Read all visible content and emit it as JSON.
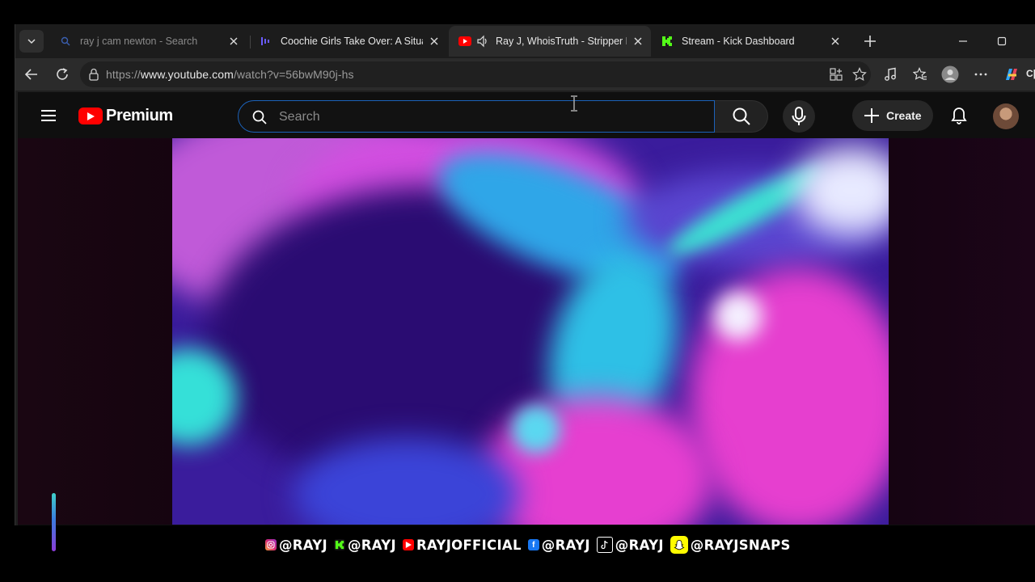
{
  "browser": {
    "tabs": [
      {
        "title": "ray j cam newton - Search",
        "favicon": "search-icon",
        "active": false,
        "dim": true
      },
      {
        "title": "Coochie Girls Take Over: A Situatio",
        "favicon": "podcast-wave-icon",
        "active": false,
        "dim": false
      },
      {
        "title": "Ray J, WhoisTruth - Stripper B",
        "favicon": "youtube-icon",
        "active": true,
        "dim": false,
        "audio": true
      },
      {
        "title": "Stream - Kick Dashboard",
        "favicon": "kick-icon",
        "active": false,
        "dim": false
      }
    ],
    "url_prefix": "https://",
    "url_host": "www.youtube.com",
    "url_path": "/watch?v=56bwM90j-hs",
    "copilot_label": "C|"
  },
  "youtube": {
    "logo_text": "Premium",
    "search_placeholder": "Search",
    "create_label": "Create"
  },
  "overlay": {
    "handles": [
      {
        "platform": "instagram",
        "icon": "instagram-icon",
        "text": "@RAYJ"
      },
      {
        "platform": "kick",
        "icon": "kick-icon",
        "text": "@RAYJ"
      },
      {
        "platform": "youtube",
        "icon": "youtube-icon",
        "text": "RAYJOFFICIAL"
      },
      {
        "platform": "facebook",
        "icon": "facebook-icon",
        "text": "@RAYJ"
      },
      {
        "platform": "tiktok",
        "icon": "tiktok-icon",
        "text": "@RAYJ"
      },
      {
        "platform": "snapchat",
        "icon": "snapchat-icon",
        "text": "@RAYJSNAPS"
      }
    ]
  },
  "colors": {
    "yt_red": "#ff0000",
    "kick_green": "#53fc18",
    "search_focus": "#1c62b9",
    "video_base": "#3a1c9c"
  }
}
